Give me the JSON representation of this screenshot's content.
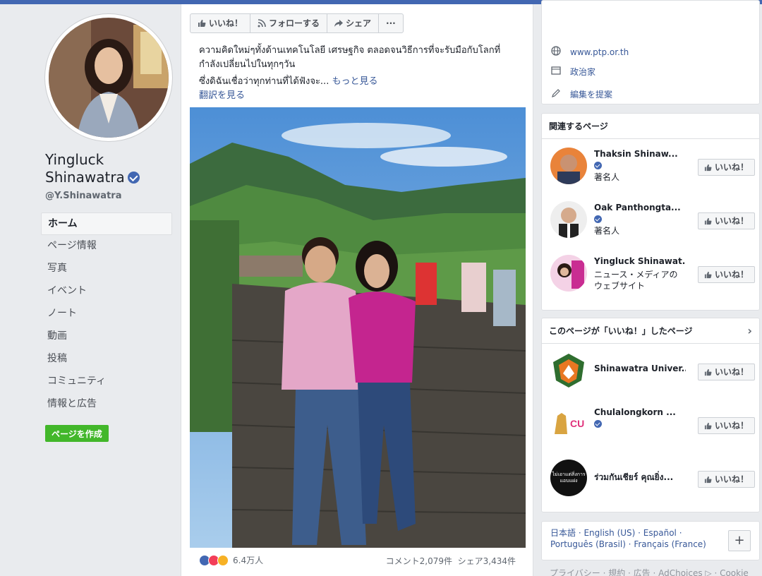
{
  "page": {
    "name_line1": "Yingluck",
    "name_line2": "Shinawatra",
    "handle": "@Y.Shinawatra"
  },
  "nav": {
    "items": [
      "ホーム",
      "ページ情報",
      "写真",
      "イベント",
      "ノート",
      "動画",
      "投稿",
      "コミュニティ",
      "情報と広告"
    ],
    "create_page": "ページを作成"
  },
  "actions": {
    "like": "いいね！",
    "follow": "フォローする",
    "share": "シェア",
    "more": "···"
  },
  "post": {
    "line1": "ความคิดใหม่ๆทั้งด้านเทคโนโลยี เศรษฐกิจ ตลอดจนวิธีการที่จะรับมือกับโลกที่",
    "line2": "กำลังเปลี่ยนไปในทุกๆวัน",
    "line3": "ซึ่งดิฉันเชื่อว่าทุกท่านที่ได้ฟังจะ...",
    "see_more": "もっと見る",
    "translate": "翻訳を見る",
    "reaction_count": "6.4万人",
    "comments": "コメント2,079件",
    "shares": "シェア3,434件"
  },
  "about": {
    "website": "www.ptp.or.th",
    "category": "政治家",
    "suggest_edit": "編集を提案"
  },
  "related": {
    "title": "関連するページ",
    "items": [
      {
        "name": "Thaksin Shinaw...",
        "sub": "著名人",
        "like": "いいね！"
      },
      {
        "name": "Oak Panthongta...",
        "sub": "著名人",
        "like": "いいね！"
      },
      {
        "name": "Yingluck Shinawat...",
        "sub": "ニュース・メディアのウェブサイト",
        "like": "いいね！"
      }
    ]
  },
  "liked_pages": {
    "title": "このページが「いいね！」したページ",
    "items": [
      {
        "name": "Shinawatra Univer...",
        "like": "いいね！"
      },
      {
        "name": "Chulalongkorn ...",
        "like": "いいね！"
      },
      {
        "name": "ร่วมกันเชียร์ คุณยิ่ง...",
        "like": "いいね！"
      }
    ],
    "logo3_text": "ไม่เอาแต่สิ่งการ แอบแฝง"
  },
  "languages": {
    "line1": "日本語 · English (US) · Español ·",
    "line2": "Português (Brasil) · Français (France)",
    "plus": "+"
  },
  "footer": "プライバシー · 規約 · 広告 · AdChoices ▷ · Cookie"
}
